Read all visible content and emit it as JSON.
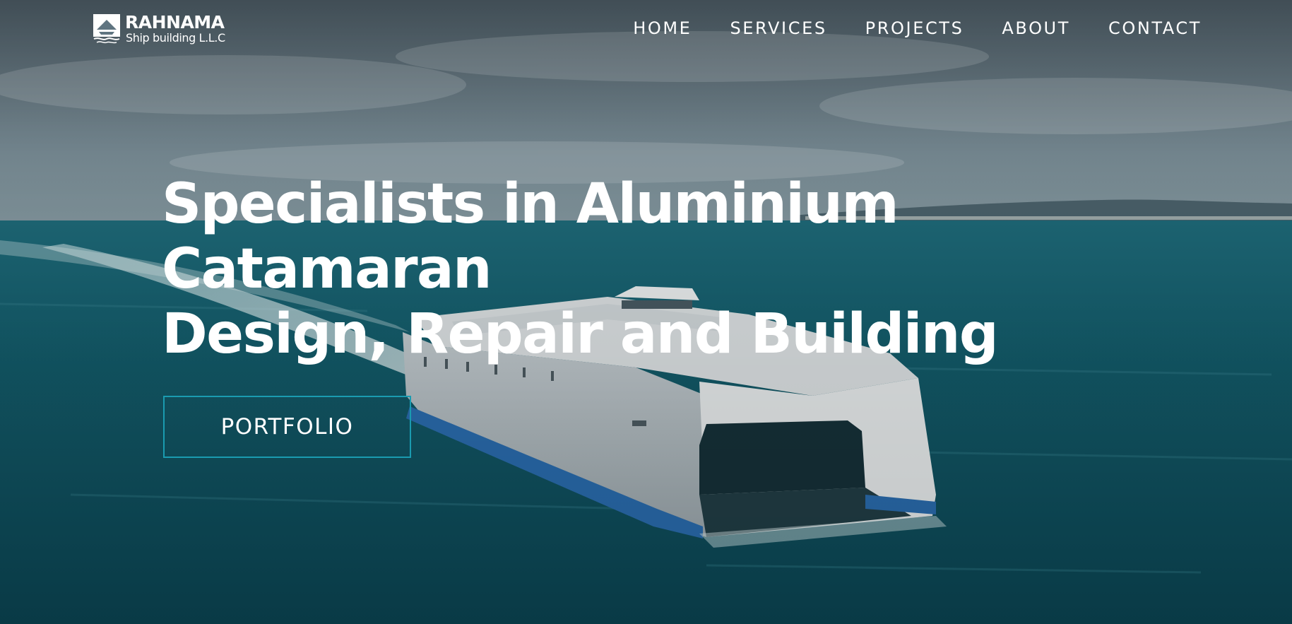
{
  "brand": {
    "name": "RAHNAMA",
    "subtitle": "Ship building L.L.C",
    "logo_icon": "ship-emblem-icon"
  },
  "nav": {
    "items": [
      {
        "label": "HOME"
      },
      {
        "label": "SERVICES"
      },
      {
        "label": "PROJECTS"
      },
      {
        "label": "ABOUT"
      },
      {
        "label": "CONTACT"
      }
    ]
  },
  "hero": {
    "headline_lines": [
      "Specialists in Aluminium",
      "Catamaran",
      "Design, Repair and Building"
    ],
    "cta_label": "PORTFOLIO",
    "background_image": "aluminium-catamaran-ferry-at-sea"
  },
  "colors": {
    "accent": "#1a9bb0",
    "text": "#ffffff",
    "sea": "#0f5f6e",
    "sky": "#5f7480"
  }
}
